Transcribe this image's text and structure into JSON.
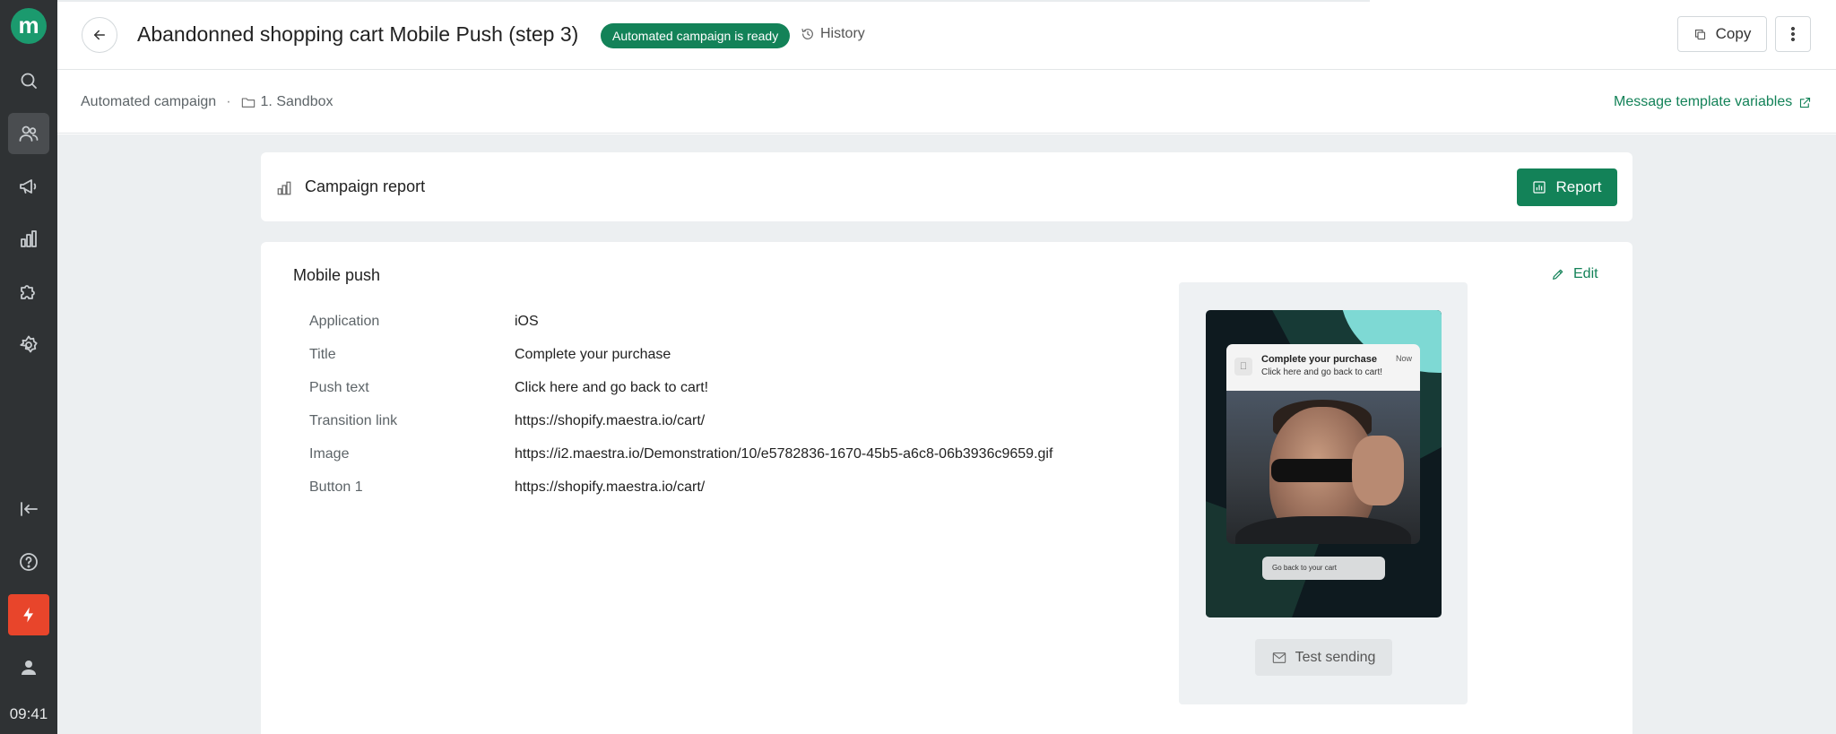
{
  "app": {
    "logo_letter": "m",
    "clock": "09:41"
  },
  "sidebar": {
    "items": [
      {
        "name": "search",
        "icon": "search-icon"
      },
      {
        "name": "users",
        "icon": "users-icon",
        "active": true
      },
      {
        "name": "campaigns",
        "icon": "megaphone-icon"
      },
      {
        "name": "analytics",
        "icon": "bar-chart-icon"
      },
      {
        "name": "integrations",
        "icon": "puzzle-icon"
      },
      {
        "name": "settings",
        "icon": "gear-icon"
      }
    ],
    "bottom": [
      {
        "name": "collapse",
        "icon": "collapse-left-icon"
      },
      {
        "name": "help",
        "icon": "help-icon"
      },
      {
        "name": "quick-actions",
        "icon": "bolt-icon"
      },
      {
        "name": "profile",
        "icon": "user-icon"
      }
    ]
  },
  "header": {
    "title": "Abandonned shopping cart Mobile Push (step 3)",
    "status": "Automated campaign is ready",
    "history": "History",
    "copy": "Copy"
  },
  "breadcrumb": {
    "type": "Automated campaign",
    "separator": "·",
    "folder": "1. Sandbox",
    "template_vars_link": "Message template variables"
  },
  "report": {
    "label": "Campaign report",
    "button": "Report"
  },
  "push": {
    "section_title": "Mobile push",
    "edit": "Edit",
    "properties": [
      {
        "key": "Application",
        "value": "iOS"
      },
      {
        "key": "Title",
        "value": "Complete your purchase"
      },
      {
        "key": "Push text",
        "value": "Click here and go back to cart!"
      },
      {
        "key": "Transition link",
        "value": "https://shopify.maestra.io/cart/"
      },
      {
        "key": "Image",
        "value": "https://i2.maestra.io/Demonstration/10/e5782836-1670-45b5-a6c8-06b3936c9659.gif"
      },
      {
        "key": "Button 1",
        "value": "https://shopify.maestra.io/cart/"
      }
    ],
    "preview": {
      "notif_title": "Complete your purchase",
      "notif_body": "Click here and go back to cart!",
      "notif_time": "Now",
      "action_button": "Go back to your cart"
    },
    "test_sending": "Test sending"
  },
  "colors": {
    "accent": "#138258",
    "sidebar_bg": "#2f3234",
    "quick_action": "#e8452b",
    "content_bg": "#eceff1"
  }
}
